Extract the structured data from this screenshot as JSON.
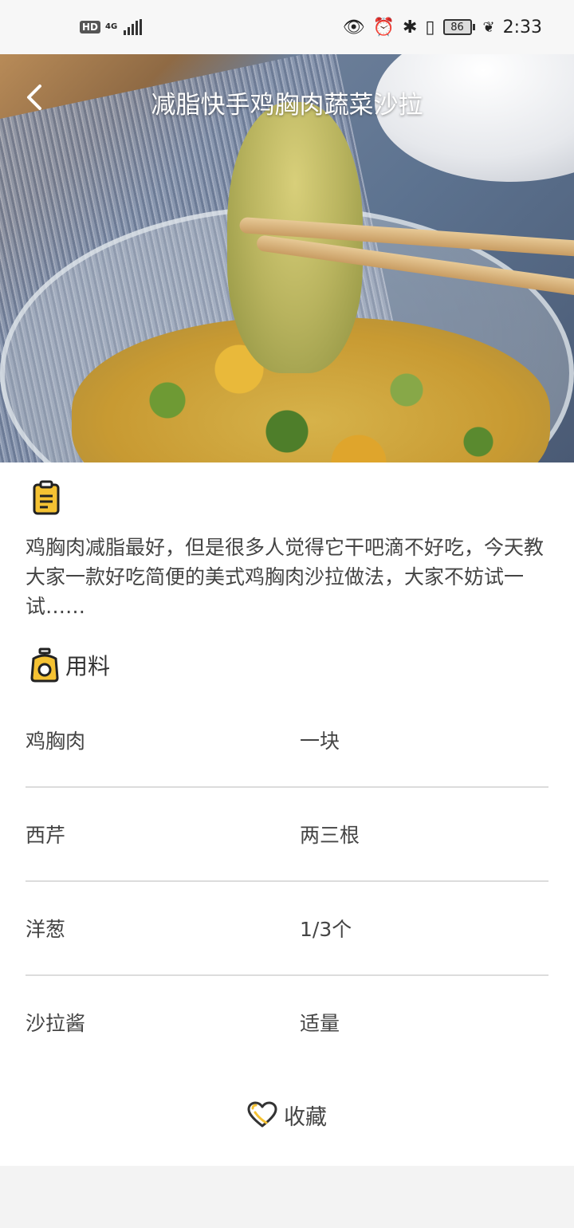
{
  "status_bar": {
    "hd": "HD",
    "network": "4G",
    "battery": "86",
    "time": "2:33"
  },
  "header": {
    "title": "减脂快手鸡胸肉蔬菜沙拉"
  },
  "description": "鸡胸肉减脂最好，但是很多人觉得它干吧滴不好吃，今天教大家一款好吃简便的美式鸡胸肉沙拉做法，大家不妨试一试……",
  "ingredients": {
    "title": "用料",
    "items": [
      {
        "name": "鸡胸肉",
        "amount": "一块"
      },
      {
        "name": "西芹",
        "amount": "两三根"
      },
      {
        "name": "洋葱",
        "amount": "1/3个"
      },
      {
        "name": "沙拉酱",
        "amount": "适量"
      }
    ]
  },
  "footer": {
    "favorite_label": "收藏"
  },
  "colors": {
    "accent": "#f5c233",
    "divider": "#dcdcdc"
  }
}
